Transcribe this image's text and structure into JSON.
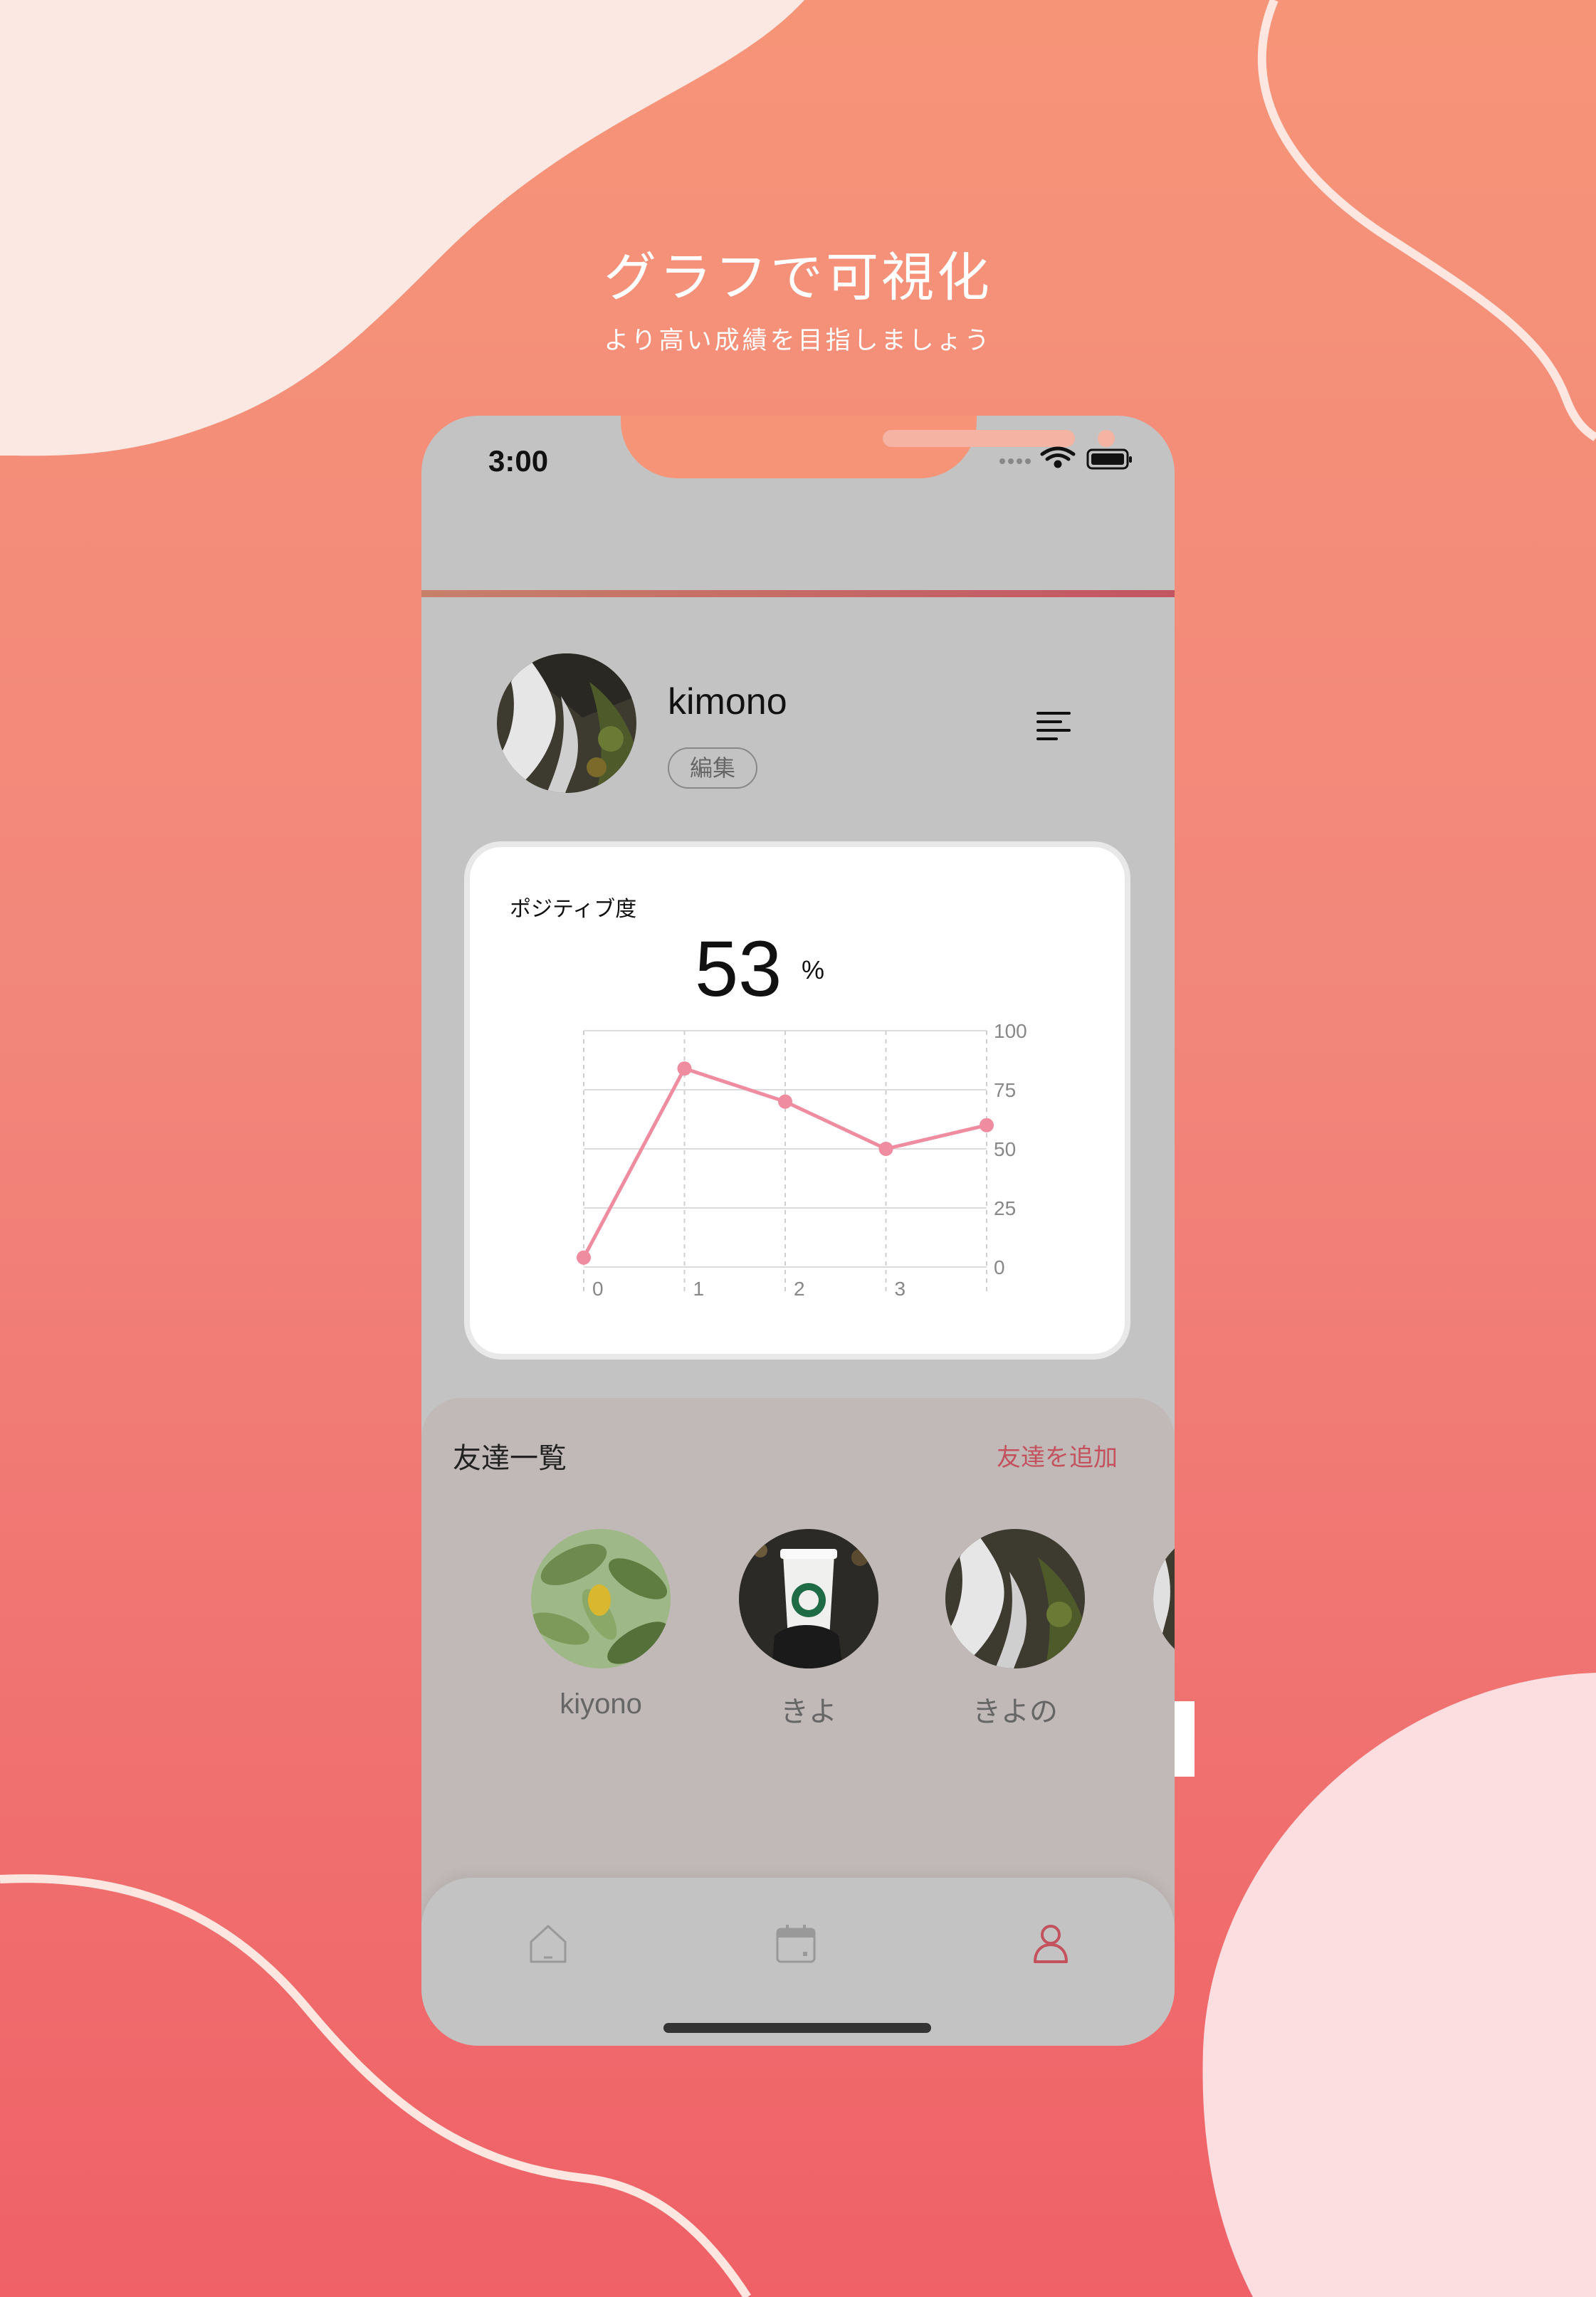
{
  "promo": {
    "title": "グラフで可視化",
    "subtitle": "より高い成績を目指しましょう"
  },
  "status_bar": {
    "time": "3:00"
  },
  "profile": {
    "username": "kimono",
    "edit_label": "編集"
  },
  "card": {
    "label": "ポジティブ度",
    "value": "53",
    "unit": "%"
  },
  "chart_data": {
    "type": "line",
    "title": "",
    "xlabel": "",
    "ylabel": "",
    "x": [
      0,
      1,
      2,
      3,
      4
    ],
    "x_tick_labels": [
      "0",
      "1",
      "2",
      "3"
    ],
    "y_tick_labels": [
      "0",
      "25",
      "50",
      "75",
      "100"
    ],
    "series": [
      {
        "values": [
          4,
          84,
          70,
          50,
          60
        ]
      }
    ],
    "xlim": [
      0,
      4
    ],
    "ylim": [
      0,
      100
    ],
    "grid": true,
    "legend": "none",
    "line_color": "#f08ca0"
  },
  "friends": {
    "title": "友達一覧",
    "add_label": "友達を追加",
    "list": [
      {
        "name": "kiyono"
      },
      {
        "name": "きよ"
      },
      {
        "name": "きよの"
      }
    ]
  },
  "tabbar": {
    "tabs": [
      {
        "icon": "home-icon"
      },
      {
        "icon": "calendar-icon"
      },
      {
        "icon": "user-icon",
        "active_color": "#c4525e"
      }
    ]
  },
  "colors": {
    "background_top": "#f69478",
    "background_bottom": "#ef6167",
    "accent": "#c4525e"
  }
}
